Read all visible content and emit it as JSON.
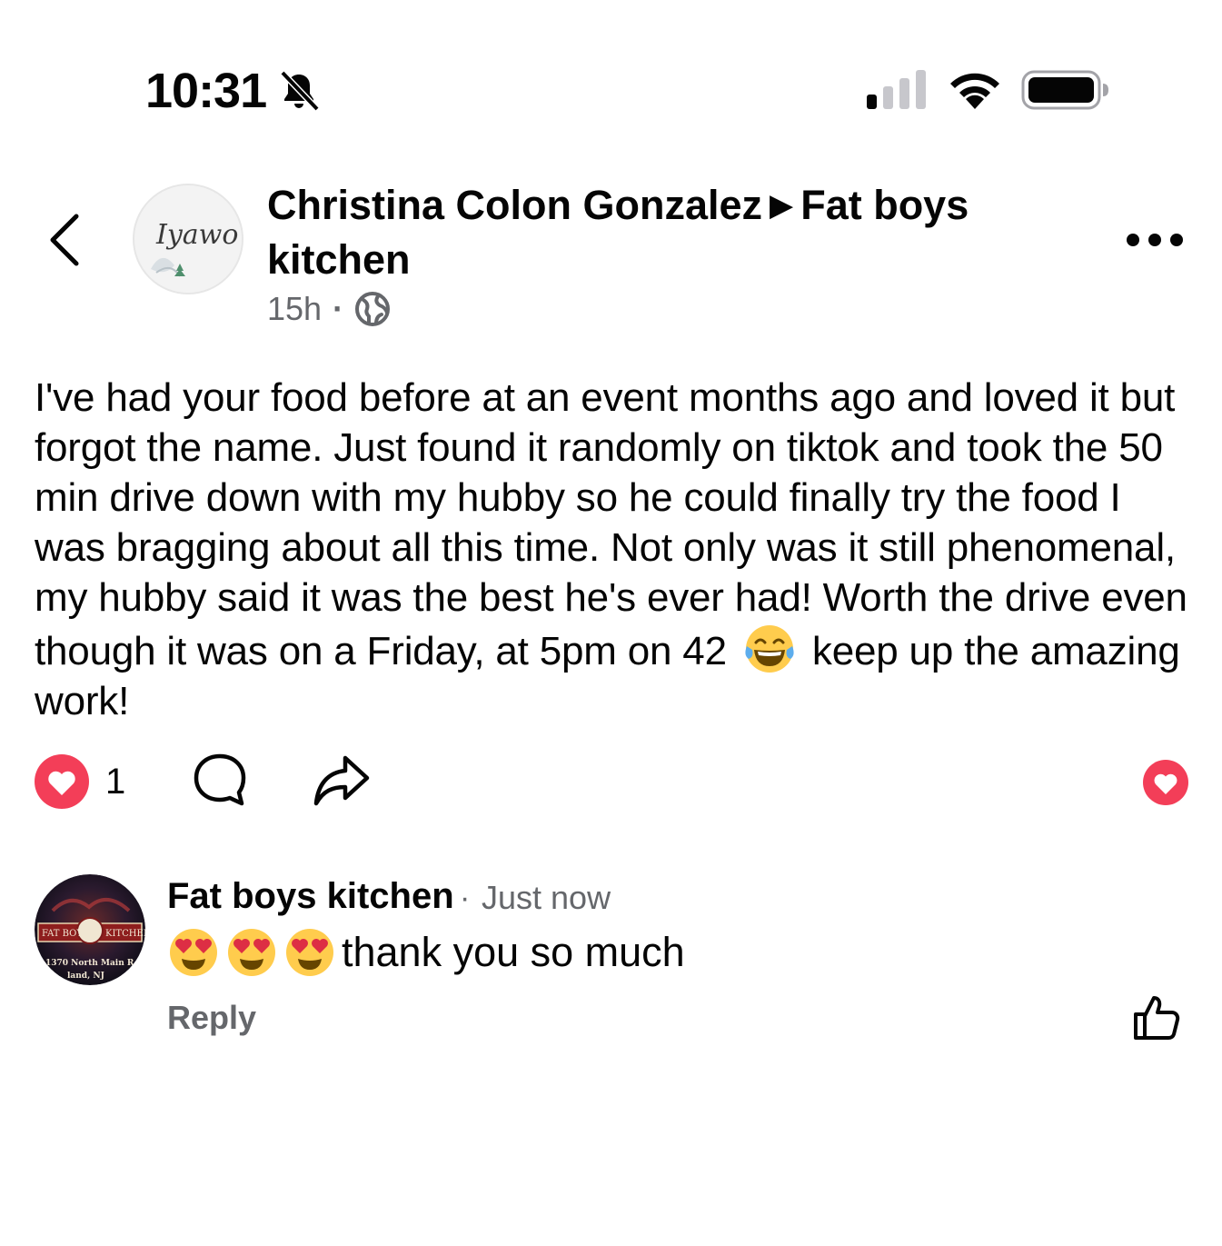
{
  "status_bar": {
    "time": "10:31",
    "icons": [
      "bell-muted-icon",
      "signal-icon",
      "wifi-icon",
      "battery-icon"
    ]
  },
  "post": {
    "author": "Christina Colon Gonzalez",
    "separator": "▶",
    "target": "Fat boys kitchen",
    "time": "15h",
    "privacy_icon": "globe-icon",
    "avatar_text": "Iyawo",
    "body_before_emoji": "I've had your food before at an event months ago and loved it but forgot the name. Just found it randomly on tiktok and took the 50 min drive down  with my hubby so he could finally try the food I was bragging about all this time. Not only was it still phenomenal, my hubby said it was the best he's ever had! Worth the drive even though it was on a Friday, at 5pm on 42",
    "body_emoji": "laughing-crying-emoji",
    "body_after_emoji": "keep up the amazing work!",
    "reaction_count": "1",
    "reaction_icon": "heart-icon"
  },
  "comment": {
    "author": "Fat boys kitchen",
    "time": "Just now",
    "emojis": [
      "heart-eyes-emoji",
      "heart-eyes-emoji",
      "heart-eyes-emoji"
    ],
    "text": "thank you so much",
    "reply_label": "Reply",
    "avatar_banner_left": "FAT BOYZ",
    "avatar_banner_right": "KITCHEN",
    "avatar_address": "1370 North Main R",
    "avatar_address_2": "land, NJ"
  },
  "colors": {
    "text": "#050505",
    "muted": "#65676b",
    "heart": "#f33e58",
    "emoji_yellow": "#ffcc4d"
  }
}
